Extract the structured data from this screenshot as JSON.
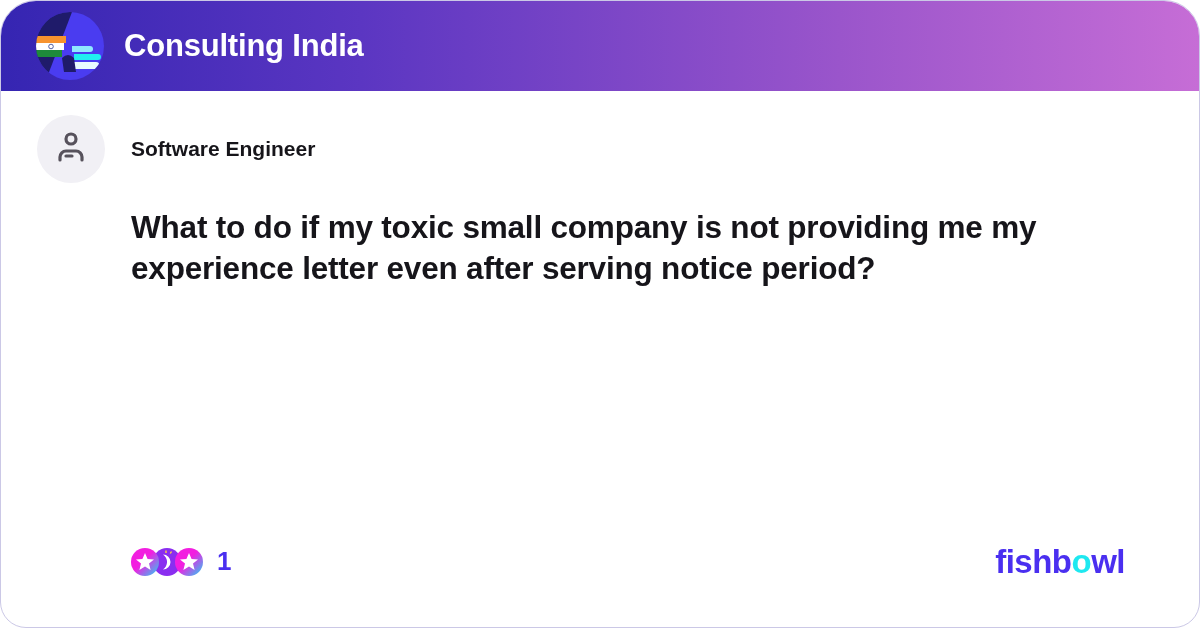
{
  "header": {
    "community_name": "Consulting India"
  },
  "post": {
    "author_title": "Software Engineer",
    "question": "What to do if my toxic small company is not providing me my experience letter even after serving notice period?"
  },
  "footer": {
    "reaction_count": "1",
    "brand_logo": {
      "parts": [
        {
          "text": "fishb",
          "color": "#4a2ff0"
        },
        {
          "text": "o",
          "color": "#1ee8f0"
        },
        {
          "text": "wl",
          "color": "#4a2ff0"
        }
      ]
    }
  }
}
